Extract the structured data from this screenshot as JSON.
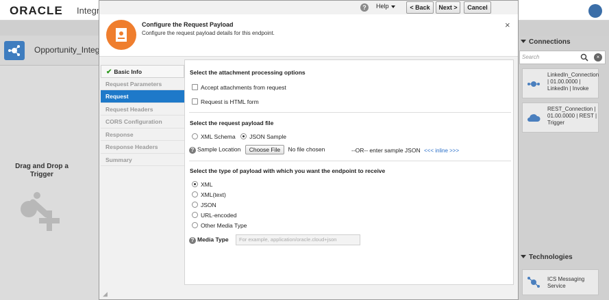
{
  "background": {
    "logo": "ORACLE",
    "app_title_partial": "Integr",
    "integration_title": "Opportunity_Integ",
    "drag_drop": "Drag and Drop a Trigger",
    "connections_panel": {
      "title": "Connections",
      "search_placeholder": "Search",
      "cards": [
        {
          "label": "LinkedIn_Connection | 01.00.0000 | LinkedIn | Invoke",
          "icon": "linkedin-adapter-icon"
        },
        {
          "label": "REST_Connection | 01.00.0000 | REST | Trigger",
          "icon": "cloud-rest-icon"
        }
      ]
    },
    "technologies_panel": {
      "title": "Technologies",
      "cards": [
        {
          "label": "ICS Messaging Service",
          "icon": "messaging-icon"
        }
      ]
    }
  },
  "toolbar": {
    "help_label": "Help",
    "back_label": "< Back",
    "next_label": "Next >",
    "cancel_label": "Cancel"
  },
  "dialog": {
    "title": "Configure the Request Payload",
    "subtitle": "Configure the request payload details for this endpoint.",
    "close_glyph": "×"
  },
  "nav": {
    "items": [
      {
        "label": "Basic Info",
        "state": "done"
      },
      {
        "label": "Request Parameters",
        "state": "disabled"
      },
      {
        "label": "Request",
        "state": "active"
      },
      {
        "label": "Request Headers",
        "state": "disabled"
      },
      {
        "label": "CORS Configuration",
        "state": "disabled"
      },
      {
        "label": "Response",
        "state": "disabled"
      },
      {
        "label": "Response Headers",
        "state": "disabled"
      },
      {
        "label": "Summary",
        "state": "disabled"
      }
    ]
  },
  "attachment": {
    "title": "Select the attachment processing options",
    "accept_label": "Accept attachments from request",
    "html_form_label": "Request is HTML form"
  },
  "payload_file": {
    "title": "Select the request payload file",
    "xml_schema_label": "XML Schema",
    "json_sample_label": "JSON Sample",
    "selected": "JSON Sample",
    "sample_location_label": "Sample Location",
    "choose_file_label": "Choose File",
    "no_file_text": "No file chosen",
    "or_text": "--OR-- enter sample JSON",
    "inline_link": "<<< inline >>>"
  },
  "payload_type": {
    "title": "Select the type of payload with which you want the endpoint to receive",
    "options": [
      "XML",
      "XML(text)",
      "JSON",
      "URL-encoded",
      "Other Media Type"
    ],
    "selected": "XML",
    "media_type_label": "Media Type",
    "media_type_placeholder": "For example, application/oracle.cloud+json"
  },
  "colors": {
    "accent_blue": "#1e79c9",
    "header_icon_orange": "#ef7e2e",
    "check_green": "#2f9a1f"
  }
}
